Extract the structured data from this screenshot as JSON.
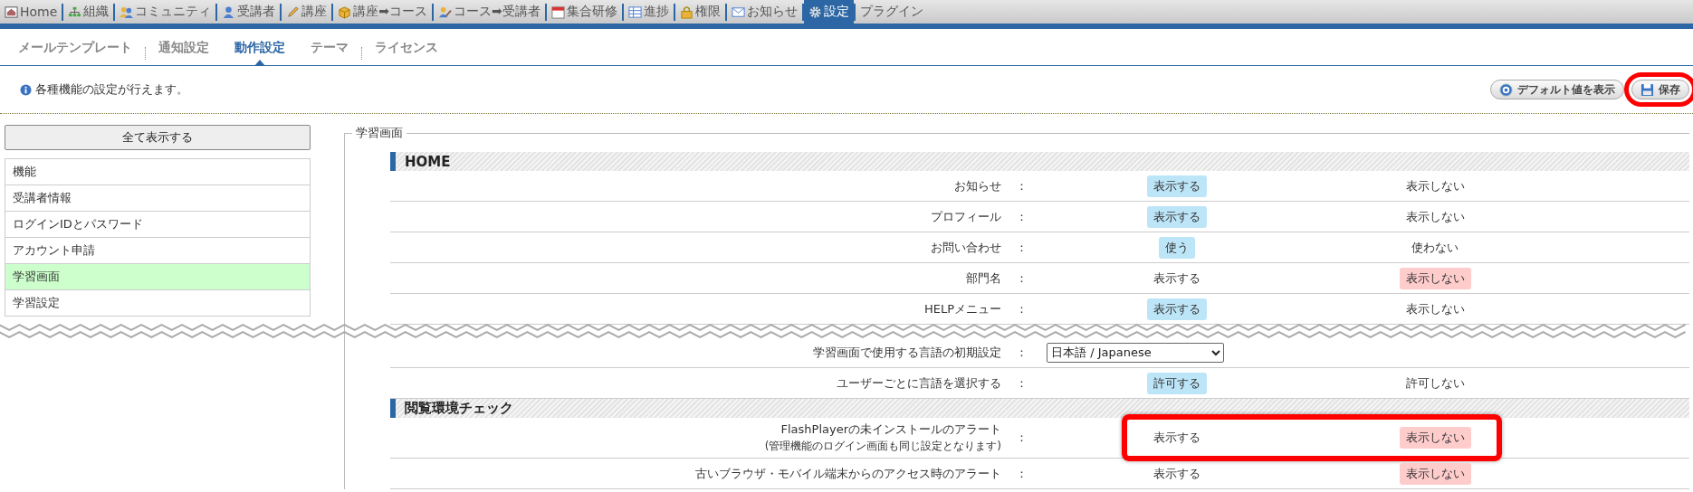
{
  "nav_tabs": [
    {
      "label": "Home",
      "selected": false
    },
    {
      "label": "組織",
      "selected": false
    },
    {
      "label": "コミュニティ",
      "selected": false
    },
    {
      "label": "受講者",
      "selected": false
    },
    {
      "label": "講座",
      "selected": false
    },
    {
      "label": "講座➡コース",
      "selected": false
    },
    {
      "label": "コース➡受講者",
      "selected": false
    },
    {
      "label": "集合研修",
      "selected": false
    },
    {
      "label": "進捗",
      "selected": false
    },
    {
      "label": "権限",
      "selected": false
    },
    {
      "label": "お知らせ",
      "selected": false
    },
    {
      "label": "設定",
      "selected": true
    },
    {
      "label": "プラグイン",
      "selected": false
    }
  ],
  "sub_tabs": [
    {
      "label": "メールテンプレート",
      "selected": false
    },
    {
      "label": "通知設定",
      "selected": false
    },
    {
      "label": "動作設定",
      "selected": true
    },
    {
      "label": "テーマ",
      "selected": false
    },
    {
      "label": "ライセンス",
      "selected": false
    }
  ],
  "info_text": "各種機能の設定が行えます。",
  "toolbar_buttons": [
    {
      "label": "デフォルト値を表示",
      "kind": "help",
      "highlighted": false
    },
    {
      "label": "保存",
      "kind": "save",
      "highlighted": true
    }
  ],
  "sidebar": {
    "show_all_button": "全て表示する",
    "items": [
      {
        "label": "機能",
        "selected": false
      },
      {
        "label": "受講者情報",
        "selected": false
      },
      {
        "label": "ログインIDとパスワード",
        "selected": false
      },
      {
        "label": "アカウント申請",
        "selected": false
      },
      {
        "label": "学習画面",
        "selected": true
      },
      {
        "label": "学習設定",
        "selected": false
      }
    ]
  },
  "panel": {
    "legend": "学習画面",
    "groups": [
      {
        "title": "HOME",
        "rows": [
          {
            "label": "お知らせ",
            "separator": "：",
            "kind": "choice",
            "highlighted": false,
            "break_after": false,
            "options": [
              {
                "label": "表示する",
                "selected": true
              },
              {
                "label": "表示しない",
                "selected": false
              }
            ]
          },
          {
            "label": "プロフィール",
            "separator": "：",
            "kind": "choice",
            "highlighted": false,
            "break_after": false,
            "options": [
              {
                "label": "表示する",
                "selected": true
              },
              {
                "label": "表示しない",
                "selected": false
              }
            ]
          },
          {
            "label": "お問い合わせ",
            "separator": "：",
            "kind": "choice",
            "highlighted": false,
            "break_after": false,
            "options": [
              {
                "label": "使う",
                "selected": true
              },
              {
                "label": "使わない",
                "selected": false
              }
            ]
          },
          {
            "label": "部門名",
            "separator": "：",
            "kind": "choice",
            "highlighted": false,
            "break_after": false,
            "options": [
              {
                "label": "表示する",
                "selected": false
              },
              {
                "label": "表示しない",
                "selected": true
              }
            ]
          },
          {
            "label": "HELPメニュー",
            "separator": "：",
            "kind": "choice",
            "highlighted": false,
            "break_after": true,
            "options": [
              {
                "label": "表示する",
                "selected": true
              },
              {
                "label": "表示しない",
                "selected": false
              }
            ]
          },
          {
            "label": "学習画面で使用する言語の初期設定",
            "separator": "：",
            "kind": "select",
            "highlighted": false,
            "break_after": false,
            "value": "日本語 / Japanese"
          },
          {
            "label": "ユーザーごとに言語を選択する",
            "separator": "：",
            "kind": "choice",
            "highlighted": false,
            "break_after": false,
            "options": [
              {
                "label": "許可する",
                "selected": true
              },
              {
                "label": "許可しない",
                "selected": false
              }
            ]
          }
        ]
      },
      {
        "title": "閲覧環境チェック",
        "rows": [
          {
            "label": "FlashPlayerの未インストールのアラート",
            "note": "(管理機能のログイン画面も同じ設定となります)",
            "separator": "：",
            "kind": "choice",
            "highlighted": true,
            "break_after": false,
            "options": [
              {
                "label": "表示する",
                "selected": false
              },
              {
                "label": "表示しない",
                "selected": true
              }
            ]
          },
          {
            "label": "古いブラウザ・モバイル端末からのアクセス時のアラート",
            "separator": "：",
            "kind": "choice",
            "highlighted": false,
            "break_after": false,
            "options": [
              {
                "label": "表示する",
                "selected": false
              },
              {
                "label": "表示しない",
                "selected": true
              }
            ]
          }
        ]
      }
    ]
  }
}
